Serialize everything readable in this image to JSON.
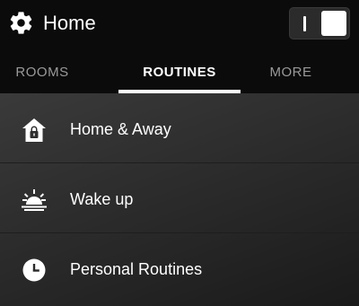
{
  "header": {
    "title": "Home",
    "settings_icon": "gear-icon",
    "power_toggle": {
      "state": "on"
    }
  },
  "tabs": [
    {
      "label": "ROOMS",
      "active": false
    },
    {
      "label": "ROUTINES",
      "active": true
    },
    {
      "label": "MORE",
      "active": false
    }
  ],
  "routines": [
    {
      "label": "Home & Away",
      "icon": "home-lock-icon"
    },
    {
      "label": "Wake up",
      "icon": "sunrise-icon"
    },
    {
      "label": "Personal Routines",
      "icon": "clock-icon"
    }
  ],
  "colors": {
    "background": "#0a0a0a",
    "text": "#ffffff",
    "inactive_tab": "#9a9a9a",
    "list_background": "#2f2f2f"
  }
}
